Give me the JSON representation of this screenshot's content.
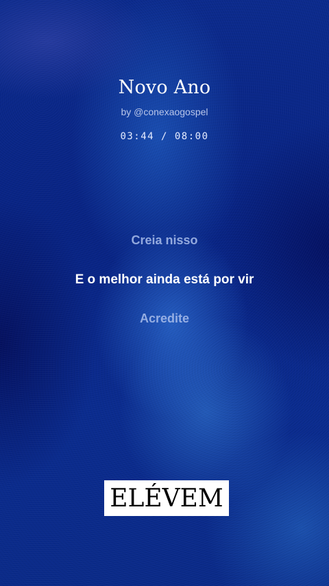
{
  "song": {
    "title": "Novo Ano",
    "byline": "by @conexaogospel",
    "time": "03:44 / 08:00"
  },
  "lyrics": {
    "previous": "Creia nisso",
    "current": "E o melhor ainda está por vir",
    "next": "Acredite"
  },
  "branding": {
    "logo_text": "ELÉVEM"
  },
  "colors": {
    "background": "#0a2a8a",
    "text_primary": "#ffffff",
    "text_dim": "#aabeeb"
  }
}
